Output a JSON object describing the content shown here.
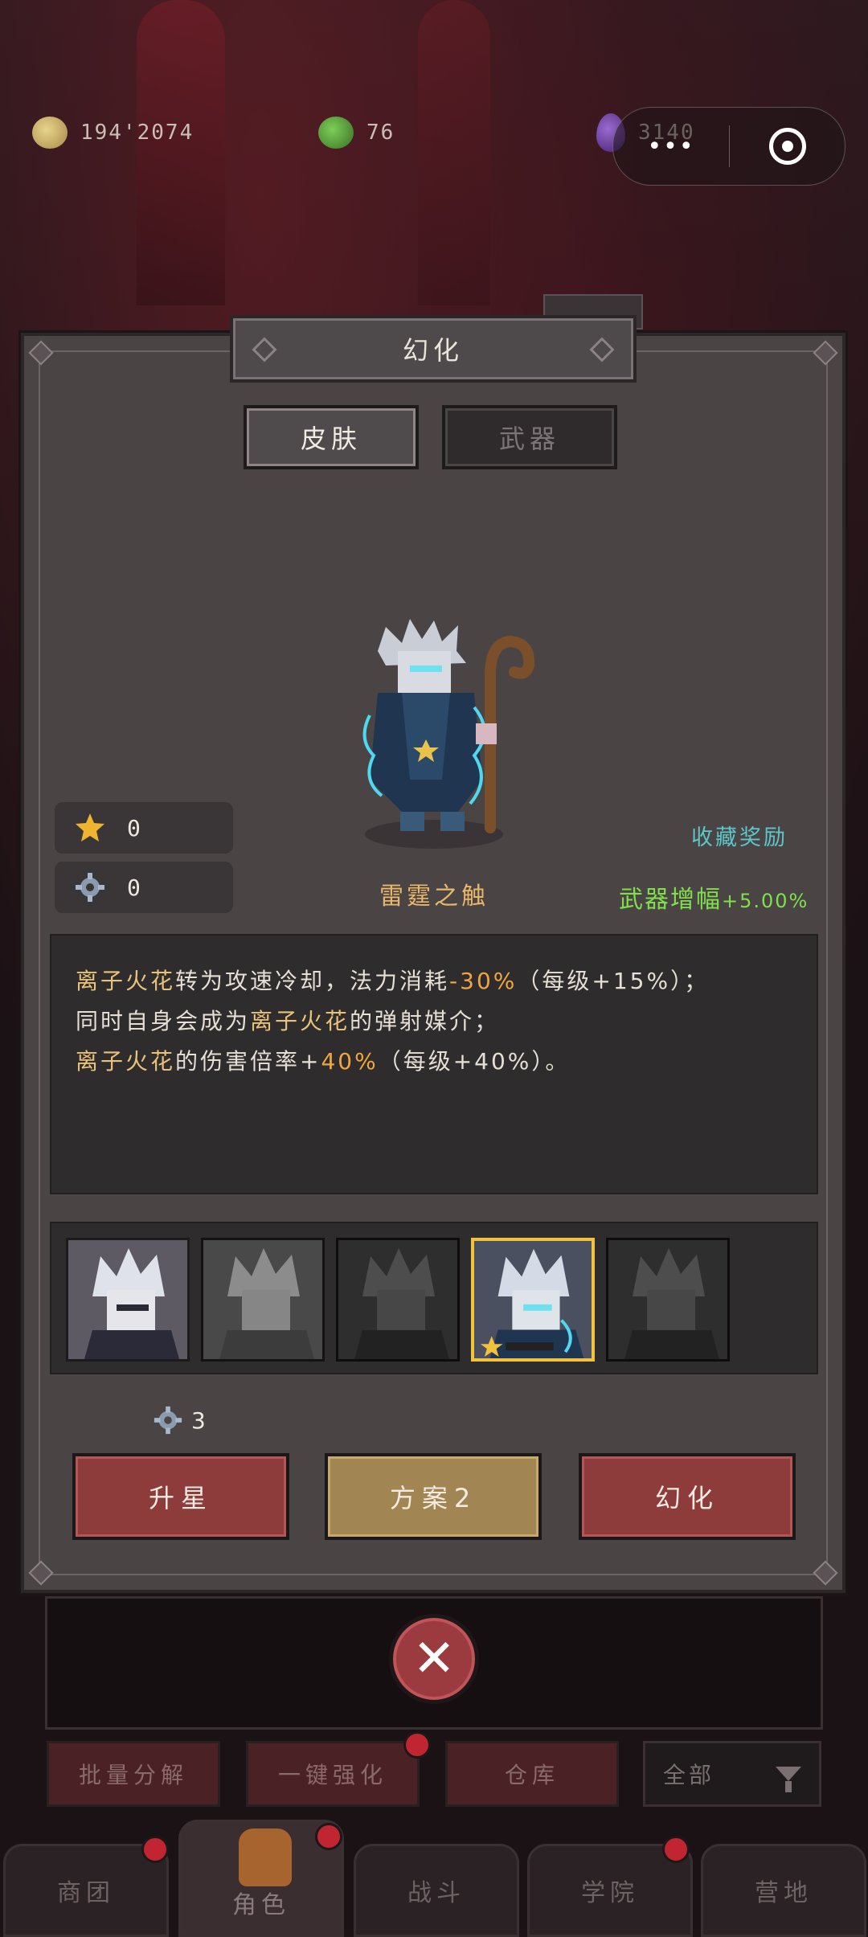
{
  "currency": [
    {
      "icon": "gold-coin-icon",
      "value": "194'2074",
      "color": "#d9c077"
    },
    {
      "icon": "green-gem-icon",
      "value": "76",
      "color": "#5a9a3c"
    },
    {
      "icon": "purple-crystal-icon",
      "value": "3140",
      "color": "#6b3fa0"
    }
  ],
  "capsule": {
    "more": "•••"
  },
  "dialog": {
    "title": "幻化",
    "tabs": [
      {
        "label": "皮肤",
        "active": true
      },
      {
        "label": "武器",
        "active": false
      }
    ],
    "counters": [
      {
        "icon": "gold-star-piece-icon",
        "value": "0"
      },
      {
        "icon": "blue-gear-icon",
        "value": "0"
      }
    ],
    "skin_name": "雷霆之触",
    "collect_reward": "收藏奖励",
    "weapon_boost": {
      "label": "武器增幅",
      "value": "+5.00%"
    },
    "description": [
      [
        {
          "t": "离子火花",
          "c": "hl"
        },
        {
          "t": "转为攻速冷却，法力消耗",
          "c": ""
        },
        {
          "t": "-30%",
          "c": "num"
        },
        {
          "t": "（每级+15%）；",
          "c": ""
        }
      ],
      [
        {
          "t": "同时自身会成为",
          "c": ""
        },
        {
          "t": "离子火花",
          "c": "hl"
        },
        {
          "t": "的弹射媒介；",
          "c": ""
        }
      ],
      [
        {
          "t": "离子火花",
          "c": "hl"
        },
        {
          "t": "的伤害倍率+",
          "c": ""
        },
        {
          "t": "40%",
          "c": "num"
        },
        {
          "t": "（每级+40%）。",
          "c": ""
        }
      ]
    ],
    "skins": [
      {
        "name": "skin-portrait-1",
        "state": "owned"
      },
      {
        "name": "skin-portrait-2",
        "state": "dim"
      },
      {
        "name": "skin-portrait-3",
        "state": "dimmer"
      },
      {
        "name": "skin-portrait-thunder",
        "state": "selected"
      },
      {
        "name": "skin-portrait-5",
        "state": "dimmer"
      }
    ],
    "cost": {
      "icon": "blue-gear-icon",
      "value": "3"
    },
    "buttons": {
      "upgrade": "升星",
      "plan": "方案2",
      "transform": "幻化"
    }
  },
  "bottom_actions": [
    "批量分解",
    "一键强化",
    "仓库"
  ],
  "filter": {
    "label": "全部",
    "icon": "funnel-icon"
  },
  "nav": [
    {
      "label": "商团",
      "badge": true
    },
    {
      "label": "角色",
      "badge": true,
      "active": true
    },
    {
      "label": "战斗",
      "badge": false
    },
    {
      "label": "学院",
      "badge": true
    },
    {
      "label": "营地",
      "badge": false
    }
  ]
}
